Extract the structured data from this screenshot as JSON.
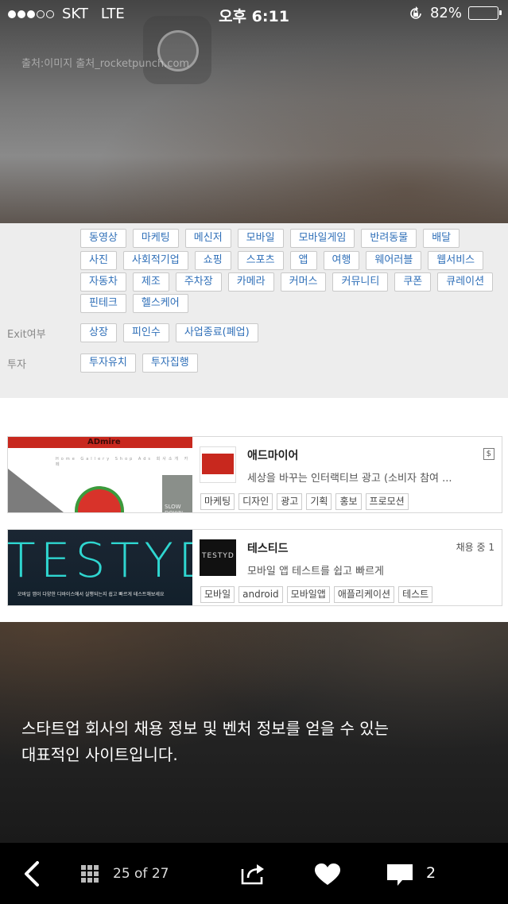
{
  "status_bar": {
    "carrier": "SKT",
    "network": "LTE",
    "time": "오후 6:11",
    "battery": "82%",
    "battery_level": 0.82,
    "signal_bars_filled": 3,
    "signal_bars_total": 5
  },
  "source_credit": "출처:이미지 출처_rocketpunch.com",
  "tag_panel": {
    "category_rows": [
      [
        "동영상",
        "마케팅",
        "메신저",
        "모바일",
        "모바일게임",
        "반려동물",
        "배달"
      ],
      [
        "사진",
        "사회적기업",
        "쇼핑",
        "스포츠",
        "앱",
        "여행",
        "웨어러블",
        "웹서비스"
      ],
      [
        "자동차",
        "제조",
        "주차장",
        "카메라",
        "커머스",
        "커뮤니티",
        "쿠폰",
        "큐레이션"
      ],
      [
        "핀테크",
        "헬스케어"
      ]
    ],
    "exit_label": "Exit여부",
    "exit_tags": [
      "상장",
      "피인수",
      "사업종료(폐업)"
    ],
    "invest_label": "투자",
    "invest_tags": [
      "투자유치",
      "투자집행"
    ]
  },
  "companies": [
    {
      "name": "애드마이어",
      "description": "세상을 바꾸는 인터랙티브 광고 (소비자 참여 ...",
      "badge": "$",
      "tags": [
        "마케팅",
        "디자인",
        "광고",
        "기획",
        "홍보",
        "프로모션"
      ],
      "image_title": "ADmire",
      "image_nav": "Home Gallery Shop Ads 회사소개 카페",
      "image_sign": "SLOW DOWN"
    },
    {
      "name": "테스티드",
      "description": "모바일 앱 테스트를 쉽고 빠르게",
      "badge": "채용 중 1",
      "tags": [
        "모바일",
        "android",
        "모바일앱",
        "애플리케이션",
        "테스트"
      ],
      "image_title": "TESTYD",
      "image_caption": "모바일 앱이 다양한 디바이스에서 실행되는지 쉽고 빠르게 테스트해보세요",
      "logo_text": "TESTYD"
    }
  ],
  "caption": {
    "line1": "스타트업 회사의 채용 정보 및 벤처 정보를 얻을 수 있는",
    "line2": "대표적인 사이트입니다."
  },
  "toolbar": {
    "page_count": "25 of 27",
    "comment_count": "2"
  },
  "colors": {
    "tag_text": "#2f6fb8",
    "admine_red": "#c8281e",
    "testyd_cyan": "#2fd6d0",
    "toolbar_bg": "#000000"
  },
  "icons": [
    "back-chevron-icon",
    "grid-icon",
    "share-icon",
    "heart-icon",
    "comment-icon",
    "battery-icon",
    "orientation-lock-icon"
  ]
}
